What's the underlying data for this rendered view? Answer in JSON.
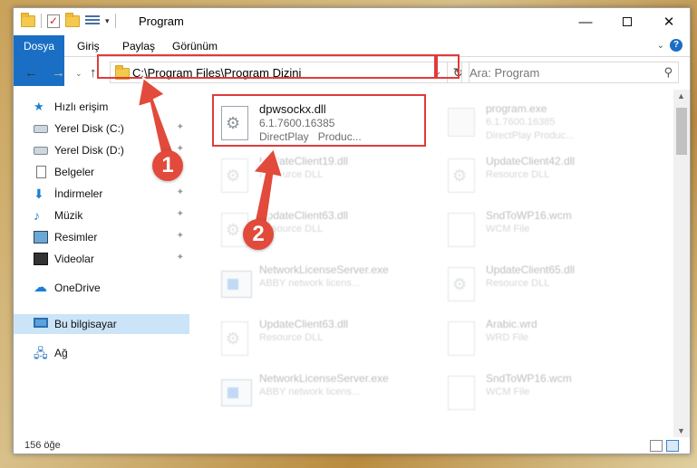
{
  "window": {
    "title": "Program",
    "controls": {
      "minimize": "—",
      "maximize": "",
      "close": "✕"
    }
  },
  "ribbon": {
    "tabs": [
      "Dosya",
      "Giriş",
      "Paylaş",
      "Görünüm"
    ],
    "expand_glyph": "⌄",
    "help_glyph": "?"
  },
  "nav": {
    "back": "←",
    "forward": "→",
    "recent": "⌄",
    "up": "↑",
    "address": "C:\\Program Files\\Program Dizini",
    "address_dropdown": "⌄",
    "refresh": "↻",
    "search_placeholder": "Ara: Program",
    "search_glyph": "⚲"
  },
  "sidebar": {
    "items": [
      {
        "label": "Hızlı erişim",
        "icon": "star-icon",
        "pinned": false
      },
      {
        "label": "Yerel Disk (C:)",
        "icon": "drive-icon",
        "pinned": true
      },
      {
        "label": "Yerel Disk (D:)",
        "icon": "drive-icon",
        "pinned": true
      },
      {
        "label": "Belgeler",
        "icon": "document-icon",
        "pinned": true
      },
      {
        "label": "İndirmeler",
        "icon": "download-icon",
        "pinned": true
      },
      {
        "label": "Müzik",
        "icon": "music-icon",
        "pinned": true
      },
      {
        "label": "Resimler",
        "icon": "pictures-icon",
        "pinned": true
      },
      {
        "label": "Videolar",
        "icon": "videos-icon",
        "pinned": true
      },
      {
        "label": "OneDrive",
        "icon": "cloud-icon",
        "pinned": false
      },
      {
        "label": "Bu bilgisayar",
        "icon": "computer-icon",
        "pinned": false,
        "selected": true
      },
      {
        "label": "Ağ",
        "icon": "network-icon",
        "pinned": false
      }
    ],
    "pin_glyph": "📌"
  },
  "files": {
    "highlighted": {
      "name": "dpwsockx.dll",
      "version": "6.1.7600.16385",
      "desc": "DirectPlay",
      "desc2": "Produc..."
    },
    "items": [
      {
        "name": "program.exe",
        "line1": "6.1.7600.16385",
        "line2": "DirectPlay   Produc...",
        "icon": "exe"
      },
      {
        "name": "UpdateClient19.dll",
        "line1": "Resource DLL",
        "icon": "gear"
      },
      {
        "name": "UpdateClient42.dll",
        "line1": "Resource DLL",
        "icon": "gear"
      },
      {
        "name": "UpdateClient63.dll",
        "line1": "Resource DLL",
        "icon": "gear"
      },
      {
        "name": "SndToWP16.wcm",
        "line1": "WCM File",
        "icon": "doc"
      },
      {
        "name": "NetworkLicenseServer.exe",
        "line1": "ABBY network licens...",
        "icon": "app"
      },
      {
        "name": "UpdateClient65.dll",
        "line1": "Resource DLL",
        "icon": "gear"
      },
      {
        "name": "UpdateClient63.dll",
        "line1": "Resource DLL",
        "icon": "gear"
      },
      {
        "name": "Arabic.wrd",
        "line1": "WRD File",
        "icon": "doc"
      },
      {
        "name": "NetworkLicenseServer.exe",
        "line1": "ABBY network licens...",
        "icon": "app"
      },
      {
        "name": "SndToWP16.wcm",
        "line1": "WCM File",
        "icon": "doc"
      }
    ]
  },
  "status": {
    "count": "156 öğe"
  },
  "annotations": {
    "badge1": "1",
    "badge2": "2",
    "color": "#e24a3b"
  }
}
